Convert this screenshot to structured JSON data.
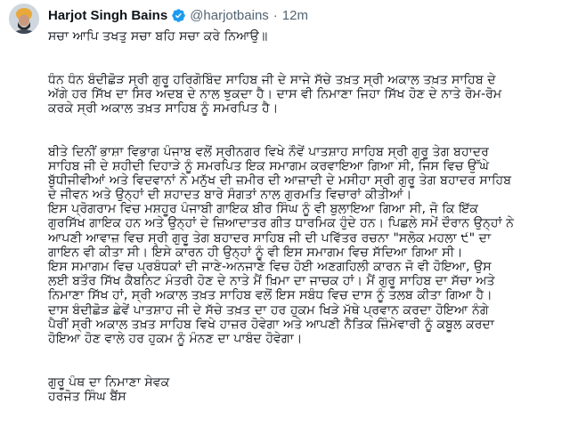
{
  "tweet": {
    "author_name": "Harjot Singh Bains",
    "verified_icon": "verified-badge-icon",
    "handle": "@harjotbains",
    "separator": "·",
    "time": "12m",
    "paragraphs": [
      [
        "ਸਚਾ ਆਪਿ ਤਖਤੁ ਸਚਾ ਬਹਿ ਸਚਾ ਕਰੇ ਨਿਆਉ॥"
      ],
      [
        "ਧੰਨ ਧੰਨ ਬੰਦੀਛੋੜ ਸ੍ਰੀ ਗੁਰੂ ਹਰਿਗੋਬਿੰਦ ਸਾਹਿਬ ਜੀ ਦੇ ਸਾਜੇ ਸੱਚੇ ਤਖ਼ਤ ਸ੍ਰੀ ਅਕਾਲ ਤਖ਼ਤ ਸਾਹਿਬ ਦੇ",
        "ਅੱਗੇ ਹਰ ਸਿੱਖ ਦਾ ਸਿਰ ਅਦਬ ਦੇ ਨਾਲ ਝੁਕਦਾ ਹੈ। ਦਾਸ ਵੀ ਨਿਮਾਣਾ ਜਿਹਾ ਸਿੱਖ ਹੋਣ ਦੇ ਨਾਤੇ ਰੋਮ-ਰੋਮ",
        "ਕਰਕੇ ਸ੍ਰੀ ਅਕਾਲ ਤਖ਼ਤ ਸਾਹਿਬ ਨੂੰ ਸਮਰਪਿਤ ਹੈ।"
      ],
      [
        "ਬੀਤੇ ਦਿਨੀਂ ਭਾਸ਼ਾ ਵਿਭਾਗ ਪੰਜਾਬ ਵਲੋਂ ਸ੍ਰੀਨਗਰ ਵਿਖੇ ਨੌਵੇਂ ਪਾਤਸ਼ਾਹ ਸਾਹਿਬ ਸ੍ਰੀ ਗੁਰੂ ਤੇਗ ਬਹਾਦਰ",
        "ਸਾਹਿਬ ਜੀ ਦੇ ਸ਼ਹੀਦੀ ਦਿਹਾੜੇ ਨੂੰ ਸਮਰਪਿਤ ਇਕ ਸਮਾਗਮ ਕਰਵਾਇਆ ਗਿਆ ਸੀ, ਜਿਸ ਵਿਚ ਉੱਘੇ",
        "ਬੁੱਧੀਜੀਵੀਆਂ ਅਤੇ ਵਿਦਵਾਨਾਂ ਨੇ ਮਨੁੱਖ ਦੀ ਜ਼ਮੀਰ ਦੀ ਆਜ਼ਾਦੀ ਦੇ ਮਸੀਹਾ ਸ੍ਰੀ ਗੁਰੂ ਤੇਗ ਬਹਾਦਰ ਸਾਹਿਬ",
        "ਦੇ ਜੀਵਨ ਅਤੇ ਉਨ੍ਹਾਂ ਦੀ ਸ਼ਹਾਦਤ ਬਾਰੇ ਸੰਗਤਾਂ ਨਾਲ ਗੁਰਮਤਿ ਵਿਚਾਰਾਂ ਕੀਤੀਆਂ।",
        "ਇਸ ਪ੍ਰੋਗਰਾਮ ਵਿਚ ਮਸ਼ਹੂਰ ਪੰਜਾਬੀ ਗਾਇਕ ਬੀਰ ਸਿੰਘ ਨੂੰ ਵੀ ਬੁਲਾਇਆ ਗਿਆ ਸੀ, ਜੋ ਕਿ ਇੱਕ",
        "ਗੁਰਸਿੱਖ ਗਾਇਕ ਹਨ ਅਤੇ ਉਨ੍ਹਾਂ ਦੇ ਜ਼ਿਆਦਾਤਰ ਗੀਤ ਧਾਰਮਿਕ ਹੁੰਦੇ ਹਨ। ਪਿਛਲੇ ਸਮੇਂ ਦੌਰਾਨ ਉਨ੍ਹਾਂ ਨੇ",
        "ਆਪਣੀ ਆਵਾਜ਼ ਵਿਚ ਸ੍ਰੀ ਗੁਰੂ ਤੇਗ ਬਹਾਦਰ ਸਾਹਿਬ ਜੀ ਦੀ ਪਵਿੱਤਰ ਰਚਨਾ \"ਸਲੋਕ ਮਹਲਾ ੯\" ਦਾ",
        "ਗਾਇਨ ਵੀ ਕੀਤਾ ਸੀ। ਇਸੇ ਕਾਰਨ ਹੀ ਉਨ੍ਹਾਂ ਨੂੰ ਵੀ ਇਸ ਸਮਾਗਮ ਵਿਚ ਸੱਦਿਆ ਗਿਆ ਸੀ।",
        "ਇਸ ਸਮਾਗਮ ਵਿਚ ਪ੍ਰਬੰਧਕਾਂ ਦੀ ਜਾਣੇ-ਅਨਜਾਣੇ ਵਿਚ ਹੋਈ ਅਣਗਹਿਲੀ ਕਾਰਨ ਜੋ ਵੀ ਹੋਇਆ, ਉਸ",
        "ਲਈ ਬਤੌਰ ਸਿੱਖ ਕੈਬਨਿਟ ਮੰਤਰੀ ਹੋਣ ਦੇ ਨਾਤੇ ਮੈਂ ਖ਼ਿਮਾ ਦਾ ਜਾਚਕ ਹਾਂ। ਮੈਂ ਗੁਰੂ ਸਾਹਿਬ ਦਾ ਸੱਚਾ ਅਤੇ",
        "ਨਿਮਾਣਾ ਸਿੱਖ ਹਾਂ, ਸ੍ਰੀ ਅਕਾਲ ਤਖ਼ਤ ਸਾਹਿਬ ਵਲੋਂ ਇਸ ਸਬੰਧ ਵਿਚ ਦਾਸ ਨੂੰ ਤਲਬ ਕੀਤਾ ਗਿਆ ਹੈ।",
        "ਦਾਸ ਬੰਦੀਛੋੜ ਛੇਵੇਂ ਪਾਤਸ਼ਾਹ ਜੀ ਦੇ ਸੱਚੇ ਤਖ਼ਤ ਦਾ ਹਰ ਹੁਕਮ ਖਿੜੇ ਮੱਥੇ ਪ੍ਰਵਾਨ ਕਰਦਾ ਹੋਇਆ ਨੰਗੇ",
        "ਪੈਰੀਂ ਸ੍ਰੀ ਅਕਾਲ ਤਖ਼ਤ ਸਾਹਿਬ ਵਿਖੇ ਹਾਜ਼ਰ ਹੋਵੇਗਾ ਅਤੇ ਆਪਣੀ ਨੈਤਿਕ ਜ਼ਿੰਮੇਵਾਰੀ ਨੂੰ ਕਬੂਲ ਕਰਦਾ",
        "ਹੋਇਆ ਹੋਣ ਵਾਲੇ ਹਰ ਹੁਕਮ ਨੂੰ ਮੰਨਣ ਦਾ ਪਾਬੰਦ ਹੋਵੇਗਾ।"
      ],
      [
        "ਗੁਰੂ ਪੰਥ ਦਾ ਨਿਮਾਣਾ ਸੇਵਕ",
        "ਹਰਜੋਤ ਸਿੰਘ ਬੈਂਸ"
      ]
    ]
  }
}
